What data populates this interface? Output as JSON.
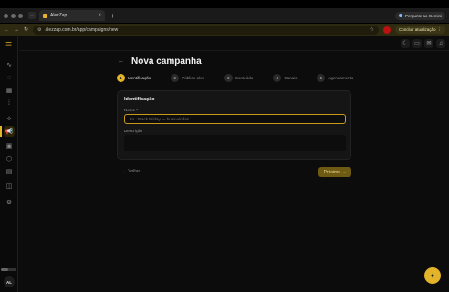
{
  "browser": {
    "tab_title": "AlezZap",
    "url": "alezzap.com.br/app/campaigns/new",
    "gemini_label": "Pergunte ao Gemini",
    "update_label": "Concluir atualização"
  },
  "user": {
    "initials": "AL"
  },
  "page": {
    "title": "Nova campanha",
    "back_glyph": "←"
  },
  "steps": [
    {
      "num": "1",
      "label": "Identificação"
    },
    {
      "num": "2",
      "label": "Público-alvo"
    },
    {
      "num": "3",
      "label": "Conteúdo"
    },
    {
      "num": "4",
      "label": "Canais"
    },
    {
      "num": "5",
      "label": "Agendamento"
    }
  ],
  "form": {
    "section_title": "Identificação",
    "name_label": "Nome *",
    "name_placeholder": "Ex.: Black Friday — boas-vindas",
    "description_label": "Descrição"
  },
  "actions": {
    "back_label": "← Voltar",
    "next_label": "Próximo →"
  },
  "colors": {
    "accent": "#e3b32a",
    "background": "#0c0c0c",
    "card": "#151515"
  }
}
